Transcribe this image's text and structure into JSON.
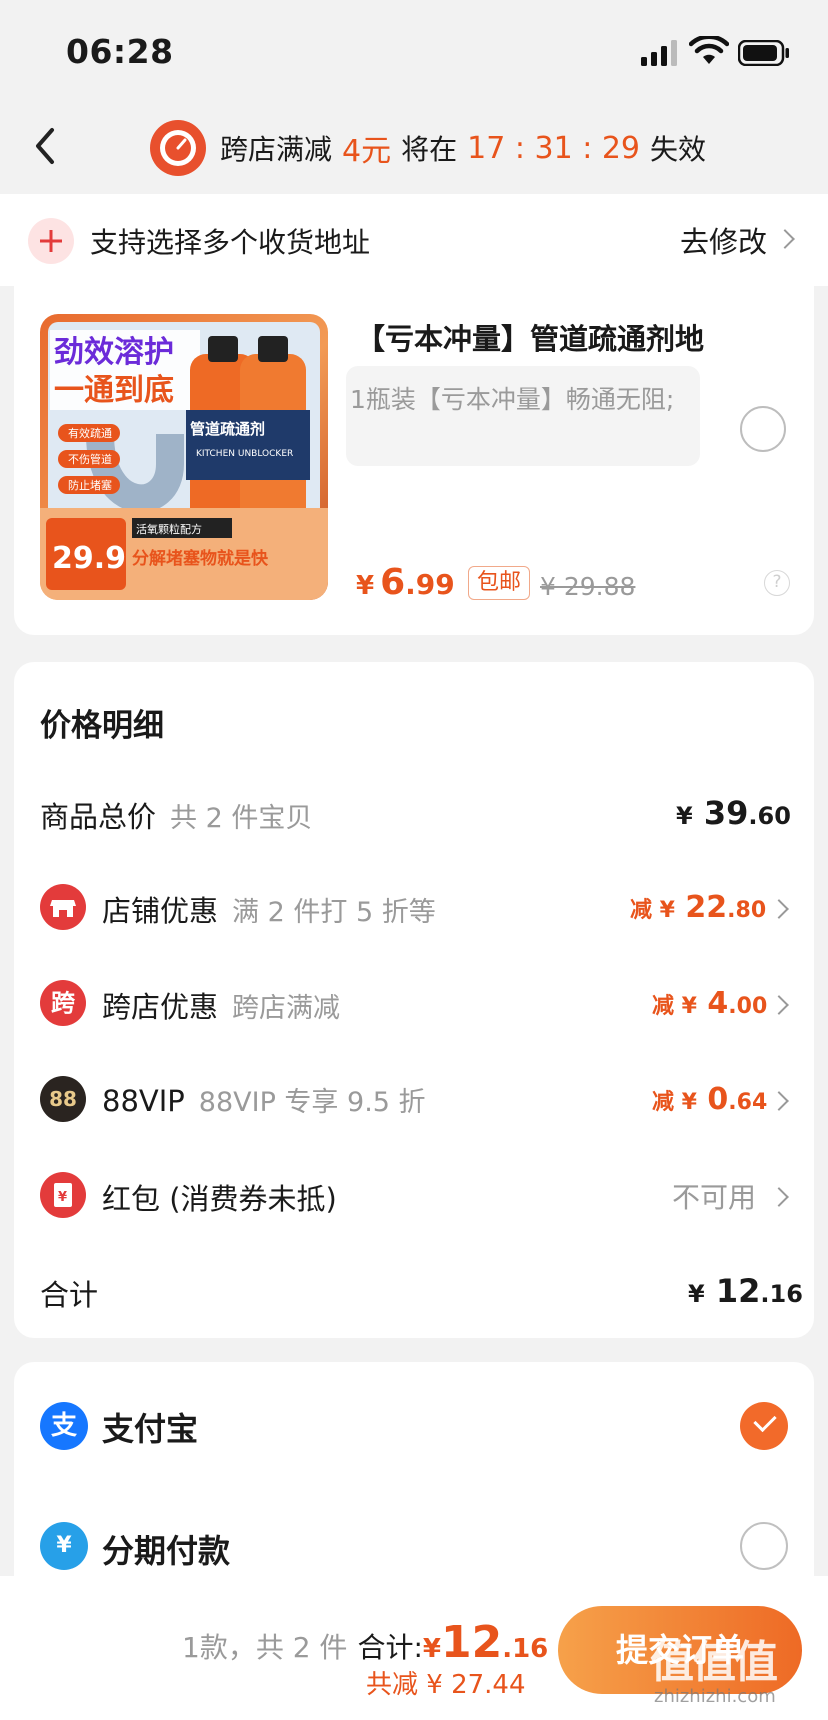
{
  "status_bar": {
    "time": "06:28"
  },
  "header": {
    "seg1": "跨店满减",
    "amount": "4元",
    "seg2": "将在",
    "countdown": "17 : 31 : 29",
    "seg3": "失效"
  },
  "address": {
    "text": "支持选择多个收货地址",
    "edit": "去修改"
  },
  "product": {
    "title": "【亏本冲量】管道疏通剂地",
    "spec": "1瓶装【亏本冲量】畅通无阻;",
    "currency": "¥",
    "price_int": "6",
    "price_dec": ".99",
    "shipping_badge": "包邮",
    "original_price": "¥ 29.88",
    "question": "?",
    "image": {
      "headline1": "劲效溶护",
      "headline2": "一通到底",
      "label1": "有效疏通",
      "label2": "不伤管道",
      "label3": "防止堵塞",
      "bottle_label": "管道疏通剂",
      "bottle_sub": "KITCHEN UNBLOCKER",
      "badge_price": "29.9",
      "formula": "活氧颗粒配方",
      "slogan": "分解堵塞物就是快"
    }
  },
  "details": {
    "title": "价格明细",
    "goods_total": {
      "label": "商品总价",
      "sub": "共 2 件宝贝",
      "currency": "¥",
      "int": "39",
      "dec": ".60"
    },
    "shop": {
      "icon": "shop-icon",
      "label": "店铺优惠",
      "sub": "满 2 件打 5 折等",
      "prefix": "减 ¥",
      "int": "22",
      "dec": ".80"
    },
    "cross": {
      "icon_text": "跨",
      "label": "跨店优惠",
      "sub": "跨店满减",
      "prefix": "减 ¥",
      "int": "4",
      "dec": ".00"
    },
    "vip": {
      "icon_text": "88",
      "label": "88VIP",
      "sub": "88VIP 专享 9.5 折",
      "prefix": "减 ¥",
      "int": "0",
      "dec": ".64"
    },
    "redpack": {
      "icon_text": "¥",
      "label": "红包 (消费券未抵)",
      "value": "不可用"
    },
    "total": {
      "label": "合计",
      "currency": "¥",
      "int": "12",
      "dec": ".16"
    }
  },
  "payment": {
    "alipay": {
      "icon_text": "支",
      "label": "支付宝"
    },
    "installment": {
      "icon_text": "¥",
      "label": "分期付款"
    }
  },
  "bottom": {
    "count": "1款，共 2 件",
    "total_label": "合计:",
    "currency": "¥",
    "total_int": "12",
    "total_dec": ".16",
    "saving": "共减 ¥ 27.44",
    "submit": "提交订单",
    "watermark": "值值值",
    "watermark_url": "zhizhizhi.com"
  },
  "colors": {
    "accent": "#e8541c",
    "red": "#e33b3b",
    "alipay": "#1677ff"
  }
}
